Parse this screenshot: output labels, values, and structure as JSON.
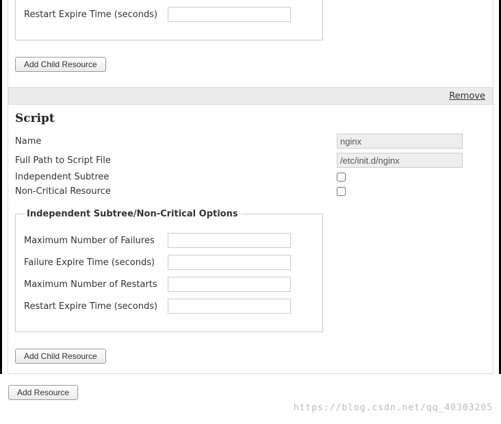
{
  "block1": {
    "options_legend": "",
    "rows": [
      {
        "label": "Restart Expire Time (seconds)",
        "value": ""
      }
    ],
    "add_child_label": "Add Child Resource"
  },
  "remove_label": "Remove",
  "script_section": {
    "heading": "Script",
    "fields": {
      "name": {
        "label": "Name",
        "value": "nginx"
      },
      "path": {
        "label": "Full Path to Script File",
        "value": "/etc/init.d/nginx"
      },
      "indep": {
        "label": "Independent Subtree",
        "checked": false
      },
      "noncrit": {
        "label": "Non-Critical Resource",
        "checked": false
      }
    },
    "options_legend": "Independent Subtree/Non-Critical Options",
    "options": [
      {
        "label": "Maximum Number of Failures",
        "value": ""
      },
      {
        "label": "Failure Expire Time (seconds)",
        "value": ""
      },
      {
        "label": "Maximum Number of Restarts",
        "value": ""
      },
      {
        "label": "Restart Expire Time (seconds)",
        "value": ""
      }
    ],
    "add_child_label": "Add Child Resource"
  },
  "add_resource_label": "Add Resource",
  "watermark": "https://blog.csdn.net/qq_40303205"
}
